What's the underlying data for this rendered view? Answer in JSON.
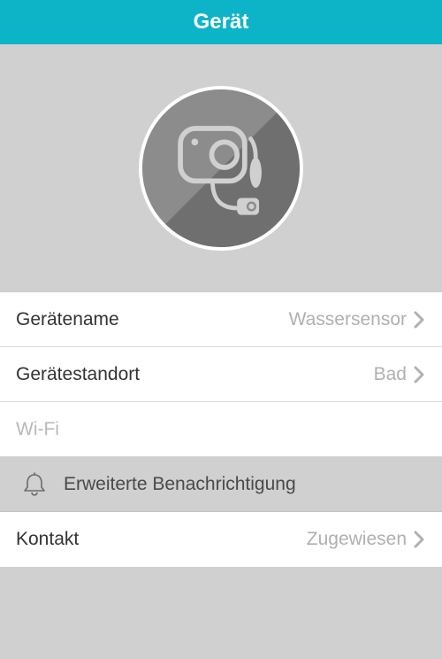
{
  "header": {
    "title": "Gerät"
  },
  "rows": {
    "device_name": {
      "label": "Gerätename",
      "value": "Wassersensor"
    },
    "device_location": {
      "label": "Gerätestandort",
      "value": "Bad"
    },
    "wifi": {
      "label": "Wi-Fi"
    },
    "advanced_notification": {
      "label": "Erweiterte Benachrichtigung"
    },
    "contact": {
      "label": "Kontakt",
      "value": "Zugewiesen"
    }
  }
}
